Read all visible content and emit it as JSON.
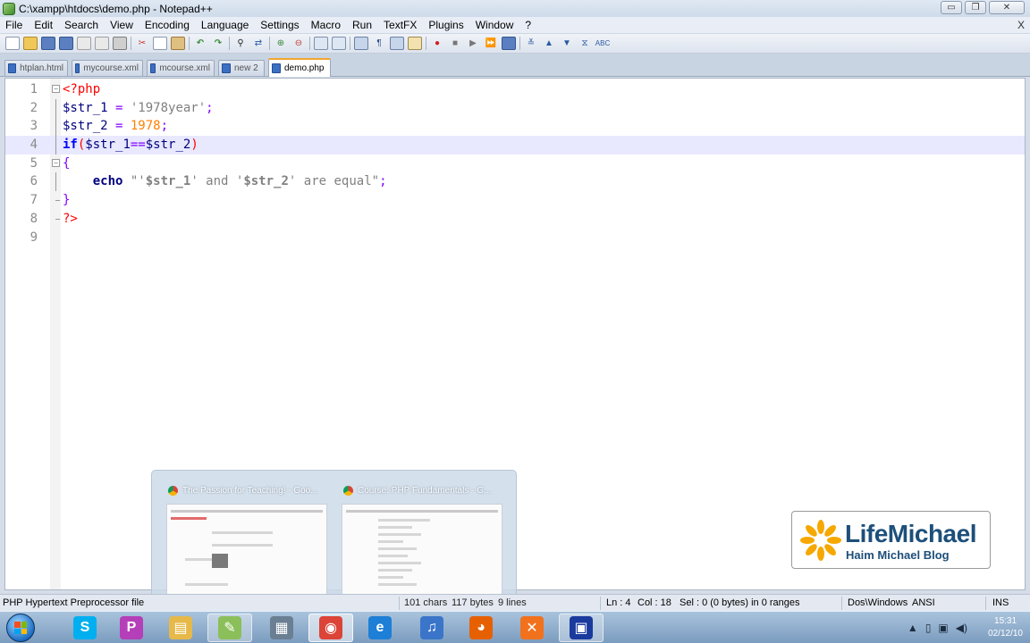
{
  "window": {
    "title": "C:\\xampp\\htdocs\\demo.php - Notepad++",
    "buttons": {
      "minimize": "▭",
      "maximize": "❐",
      "close": "✕"
    }
  },
  "menu": {
    "items": [
      "File",
      "Edit",
      "Search",
      "View",
      "Encoding",
      "Language",
      "Settings",
      "Macro",
      "Run",
      "TextFX",
      "Plugins",
      "Window",
      "?"
    ],
    "close_label": "X"
  },
  "tabs": [
    {
      "label": "htplan.html",
      "active": false
    },
    {
      "label": "mycourse.xml",
      "active": false
    },
    {
      "label": "mcourse.xml",
      "active": false
    },
    {
      "label": "new  2",
      "active": false
    },
    {
      "label": "demo.php",
      "active": true
    }
  ],
  "editor": {
    "current_line": 4,
    "lines": [
      {
        "n": "1",
        "tokens": [
          [
            "kw-tag",
            "<?php"
          ]
        ]
      },
      {
        "n": "2",
        "tokens": [
          [
            "var",
            "$str_1"
          ],
          [
            "op",
            " = "
          ],
          [
            "str",
            "'1978year'"
          ],
          [
            "op",
            ";"
          ]
        ]
      },
      {
        "n": "3",
        "tokens": [
          [
            "var",
            "$str_2"
          ],
          [
            "op",
            " = "
          ],
          [
            "num",
            "1978"
          ],
          [
            "op",
            ";"
          ]
        ]
      },
      {
        "n": "4",
        "tokens": [
          [
            "kw",
            "if"
          ],
          [
            "paren",
            "("
          ],
          [
            "var",
            "$str_1"
          ],
          [
            "op",
            "=="
          ],
          [
            "var",
            "$str_2"
          ],
          [
            "paren",
            ")"
          ]
        ]
      },
      {
        "n": "5",
        "tokens": [
          [
            "op",
            "{"
          ]
        ]
      },
      {
        "n": "6",
        "tokens": [
          [
            "op",
            "    "
          ],
          [
            "echo",
            "echo"
          ],
          [
            "op",
            " "
          ],
          [
            "str",
            "\"'"
          ],
          [
            "strvar",
            "$str_1"
          ],
          [
            "str",
            "' and '"
          ],
          [
            "strvar",
            "$str_2"
          ],
          [
            "str",
            "' are equal\""
          ],
          [
            "op",
            ";"
          ]
        ]
      },
      {
        "n": "7",
        "tokens": [
          [
            "op",
            "}"
          ]
        ]
      },
      {
        "n": "8",
        "tokens": [
          [
            "kw-tag",
            "?>"
          ]
        ]
      },
      {
        "n": "9",
        "tokens": []
      }
    ]
  },
  "taskbar_preview": {
    "items": [
      {
        "title": "The Passion for Teaching! - Goo..."
      },
      {
        "title": "Course: PHP Fundamentals - G..."
      }
    ]
  },
  "logo": {
    "brand": "LifeMichael",
    "subtitle": "Haim Michael Blog"
  },
  "statusbar": {
    "file_type": "PHP Hypertext Preprocessor file",
    "chars": "101 chars",
    "bytes": "117 bytes",
    "lines": "9 lines",
    "ln": "Ln : 4",
    "col": "Col : 18",
    "sel": "Sel : 0 (0 bytes) in 0 ranges",
    "eol": "Dos\\Windows",
    "encoding": "ANSI",
    "mode": "INS"
  },
  "taskbar": {
    "apps": [
      {
        "name": "skype",
        "glyph": "S",
        "color": "#00aff0"
      },
      {
        "name": "p-app",
        "glyph": "P",
        "color": "#b53fb8"
      },
      {
        "name": "explorer",
        "glyph": "▤",
        "color": "#e6b94a"
      },
      {
        "name": "notepadpp",
        "glyph": "✎",
        "color": "#8bbf5a"
      },
      {
        "name": "files",
        "glyph": "▦",
        "color": "#6b7f93"
      },
      {
        "name": "chrome",
        "glyph": "◉",
        "color": "#db4437"
      },
      {
        "name": "ie",
        "glyph": "e",
        "color": "#1e7fd6"
      },
      {
        "name": "itunes",
        "glyph": "♫",
        "color": "#3a75c9"
      },
      {
        "name": "firefox",
        "glyph": "◕",
        "color": "#e66000"
      },
      {
        "name": "xampp",
        "glyph": "✕",
        "color": "#f2711c"
      },
      {
        "name": "vmware",
        "glyph": "▣",
        "color": "#1a3a9e"
      }
    ],
    "clock_time": "15:31",
    "clock_date": "02/12/10"
  }
}
